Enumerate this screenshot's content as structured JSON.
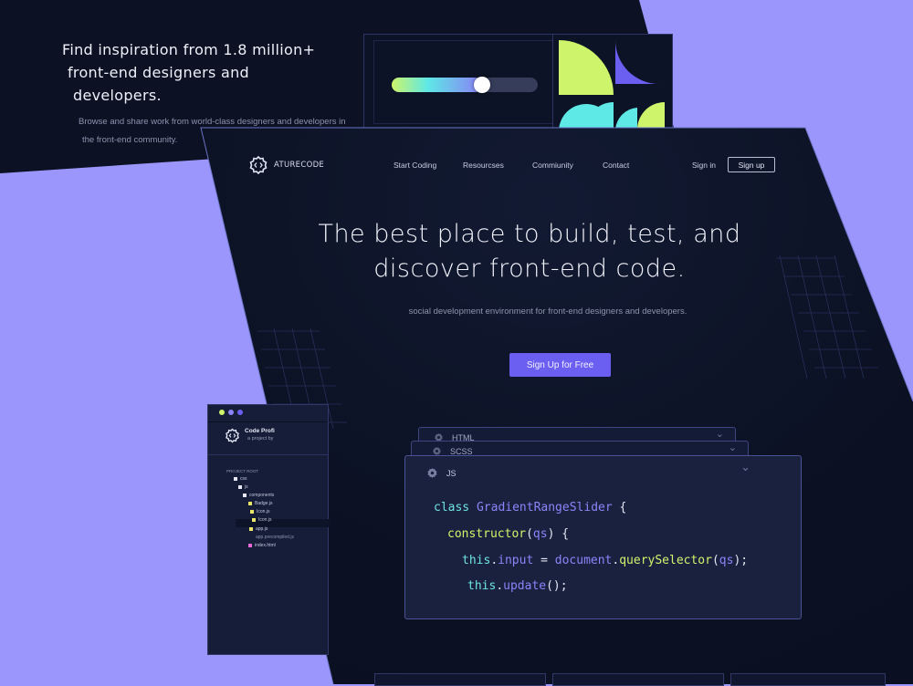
{
  "back_panel": {
    "headline": [
      "Find inspiration from 1.8 million+",
      "front-end designers and",
      "developers."
    ],
    "subtitle": [
      "Browse and share work from world-class designers and developers in",
      "the front-end community."
    ],
    "slider_value": 0.62
  },
  "brand": {
    "name": "ATURECODE",
    "logo_icon": "gear-code-icon"
  },
  "nav": {
    "links": [
      {
        "label": "Start Coding"
      },
      {
        "label": "Resourcses"
      },
      {
        "label": "Commiunity"
      },
      {
        "label": "Contact"
      }
    ],
    "sign_in": "Sign in",
    "sign_up": "Sign up"
  },
  "hero": {
    "title": [
      "The best place to build, test, and",
      "discover front-end code."
    ],
    "subtitle": "social development environment for front-end designers and developers.",
    "cta": "Sign Up for Free"
  },
  "code_panels": {
    "tabs": [
      "HTML",
      "SCSS",
      "JS"
    ],
    "active_tab": "JS",
    "code": {
      "line1": {
        "kw": "class",
        "name": "GradientRangeSlider",
        "rest": " {"
      },
      "line2": {
        "fn": "constructor",
        "open": "(",
        "arg": "qs",
        "close": ") {"
      },
      "line3": {
        "this": "this",
        "dot1": ".",
        "prop": "input",
        "eq": " = ",
        "obj": "document",
        "dot2": ".",
        "method": "querySelector",
        "open": "(",
        "arg": "qs",
        "close": ");"
      },
      "line4": {
        "this": "this",
        "dot": ".",
        "method": "update",
        "close": "();"
      }
    }
  },
  "side_panel": {
    "title": "Code Profi",
    "subtitle": "a project by",
    "root_label": "PROJECT ROOT",
    "tree": [
      {
        "label": "css",
        "color": "#e6e8f5"
      },
      {
        "label": "js",
        "color": "#e6e8f5"
      },
      {
        "label": "components",
        "color": "#e6e8f5"
      },
      {
        "label": "Badge.js",
        "color": "#e9e66a"
      },
      {
        "label": "Icon.js",
        "color": "#e9e66a"
      },
      {
        "label": "Icon.js",
        "color": "#e9e66a"
      },
      {
        "label": "app.js",
        "color": "#e9e66a"
      },
      {
        "label": "app.precompiled.js",
        "color": ""
      },
      {
        "label": "index.html",
        "color": "#e86ad8"
      }
    ]
  },
  "colors": {
    "background": "#9b96fb",
    "panel": "#0b1122",
    "accent": "#6b5ff2",
    "lime": "#cdf46a",
    "cyan": "#5ee8e6"
  }
}
